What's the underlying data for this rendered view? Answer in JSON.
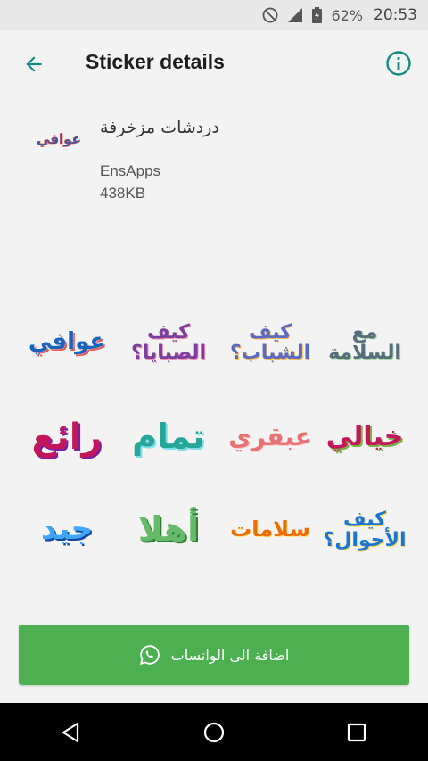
{
  "status_bar": {
    "battery": "62%",
    "time": "20:53",
    "icons": [
      "dnd-icon",
      "signal-icon",
      "battery-icon"
    ]
  },
  "app_bar": {
    "title": "Sticker details",
    "back_icon": "arrow-back-icon",
    "info_icon": "info-icon"
  },
  "pack": {
    "name": "دردشات مزخرفة",
    "tray_text": "عوافي",
    "publisher": "EnsApps",
    "size": "438KB"
  },
  "stickers": [
    {
      "text": "عوافي",
      "color": "#1565c0"
    },
    {
      "text": "كيف الصبايا؟",
      "color": "#7b3fa0"
    },
    {
      "text": "كيف الشباب؟",
      "color": "#5c6bc0"
    },
    {
      "text": "مع السلامة",
      "color": "#546e7a"
    },
    {
      "text": "رائع",
      "color": "#c2185b"
    },
    {
      "text": "تمام",
      "color": "#26a69a"
    },
    {
      "text": "عبقري",
      "color": "#e57373"
    },
    {
      "text": "خيالي",
      "color": "#c2185b"
    },
    {
      "text": "جيد",
      "color": "#42a5f5"
    },
    {
      "text": "أهلا",
      "color": "#66bb6a"
    },
    {
      "text": "سلامات",
      "color": "#ef6c00"
    },
    {
      "text": "كيف الأحوال؟",
      "color": "#1976d2"
    }
  ],
  "actions": {
    "add_label": "اضافة الى الواتساب",
    "add_icon": "whatsapp-icon",
    "button_color": "#4caf50"
  },
  "nav": {
    "icons": [
      "nav-back-icon",
      "nav-home-icon",
      "nav-recents-icon"
    ]
  }
}
